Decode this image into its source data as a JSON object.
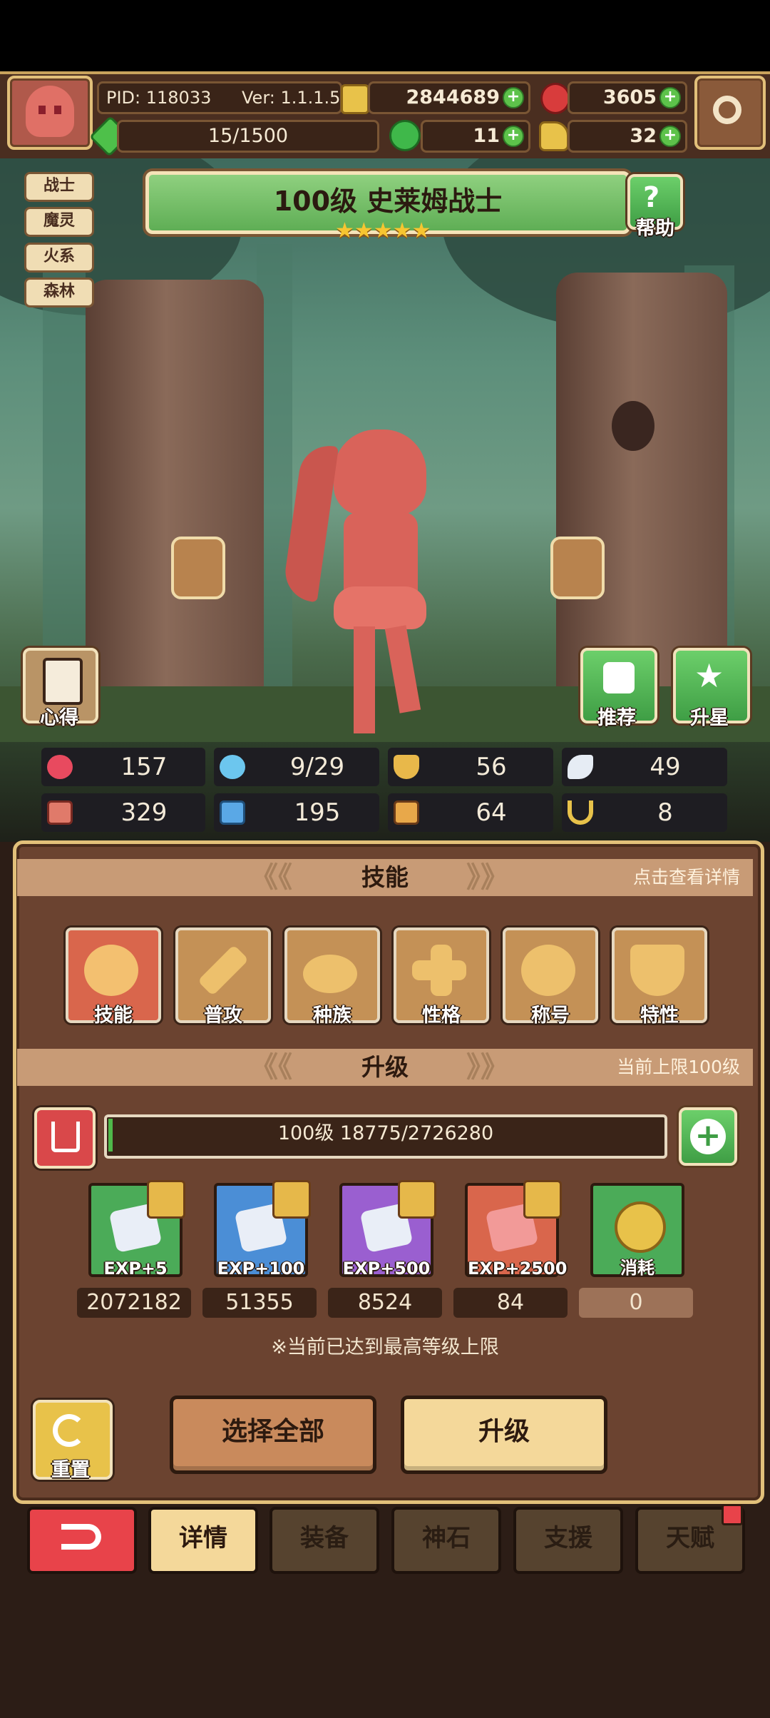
{
  "header": {
    "pid": "PID: 118033",
    "version": "Ver: 1.1.1.5",
    "gold": "2844689",
    "ruby": "3605",
    "energy": "15/1500",
    "clover": "11",
    "key": "32"
  },
  "hero": {
    "tags": [
      "战士",
      "魔灵",
      "火系",
      "森林"
    ],
    "title": "100级  史莱姆战士",
    "stars": "★★★★★",
    "help_label": "帮助",
    "notes_label": "心得",
    "recommend_label": "推荐",
    "star_up_label": "升星"
  },
  "stats": {
    "hp": "157",
    "mana": "9/29",
    "armor": "56",
    "speed": "49",
    "attack": "329",
    "magic": "195",
    "defense": "64",
    "luck": "8"
  },
  "skills": {
    "heading": "技能",
    "hint": "点击查看详情",
    "items": [
      "技能",
      "普攻",
      "种族",
      "性格",
      "称号",
      "特性"
    ]
  },
  "upgrade": {
    "heading": "升级",
    "cap": "当前上限100级",
    "progress_text": "100级  18775/2726280",
    "progress_fraction": 0.0069,
    "items": [
      {
        "label": "EXP+5",
        "count": "2072182",
        "color": "#4bab58"
      },
      {
        "label": "EXP+100",
        "count": "51355",
        "color": "#4b8ed6"
      },
      {
        "label": "EXP+500",
        "count": "8524",
        "color": "#9a5fd0"
      },
      {
        "label": "EXP+2500",
        "count": "84",
        "color": "#d9664c"
      },
      {
        "label": "消耗",
        "count": "0",
        "color": "#4bab58"
      }
    ],
    "notice": "※当前已达到最高等级上限"
  },
  "actions": {
    "reset": "重置",
    "select_all": "选择全部",
    "upgrade": "升级"
  },
  "tabs": [
    "详情",
    "装备",
    "神石",
    "支援",
    "天赋"
  ]
}
